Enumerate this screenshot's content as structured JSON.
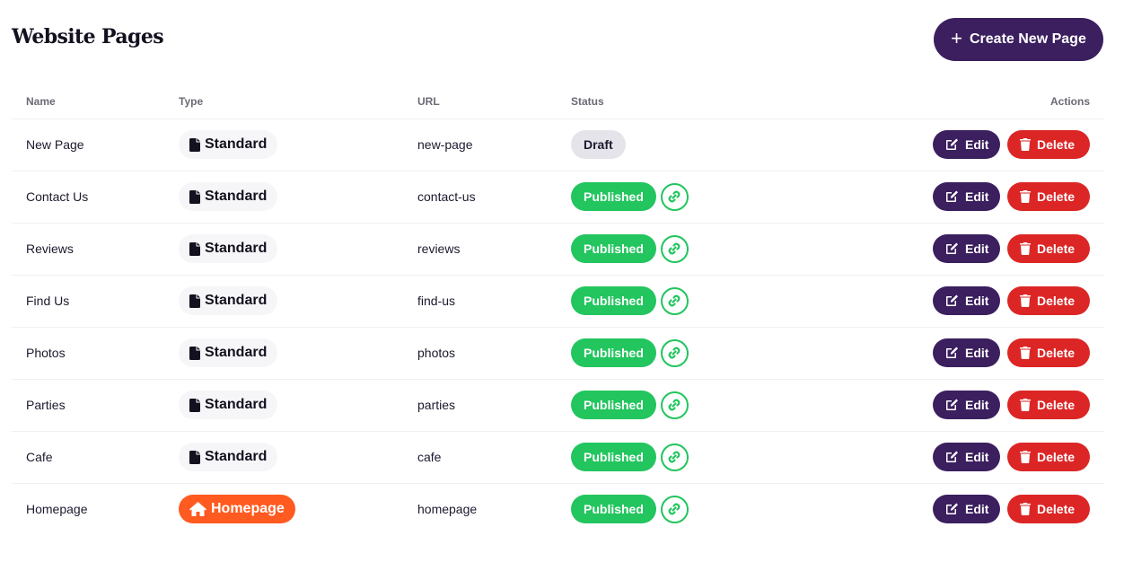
{
  "header": {
    "title": "Website Pages",
    "create_button": "Create New Page"
  },
  "table": {
    "columns": [
      "Name",
      "Type",
      "URL",
      "Status",
      "Actions"
    ],
    "rows": [
      {
        "name": "New Page",
        "type": "Standard",
        "type_icon": "file-icon",
        "url": "new-page",
        "status": "Draft",
        "has_link": false
      },
      {
        "name": "Contact Us",
        "type": "Standard",
        "type_icon": "file-icon",
        "url": "contact-us",
        "status": "Published",
        "has_link": true
      },
      {
        "name": "Reviews",
        "type": "Standard",
        "type_icon": "file-icon",
        "url": "reviews",
        "status": "Published",
        "has_link": true
      },
      {
        "name": "Find Us",
        "type": "Standard",
        "type_icon": "file-icon",
        "url": "find-us",
        "status": "Published",
        "has_link": true
      },
      {
        "name": "Photos",
        "type": "Standard",
        "type_icon": "file-icon",
        "url": "photos",
        "status": "Published",
        "has_link": true
      },
      {
        "name": "Parties",
        "type": "Standard",
        "type_icon": "file-icon",
        "url": "parties",
        "status": "Published",
        "has_link": true
      },
      {
        "name": "Cafe",
        "type": "Standard",
        "type_icon": "file-icon",
        "url": "cafe",
        "status": "Published",
        "has_link": true
      },
      {
        "name": "Homepage",
        "type": "Homepage",
        "type_icon": "home-icon",
        "url": "homepage",
        "status": "Published",
        "has_link": true
      }
    ],
    "actions": {
      "edit": "Edit",
      "delete": "Delete"
    }
  },
  "colors": {
    "primary": "#3b1f5e",
    "danger": "#dc2626",
    "success": "#22c55e",
    "homepage": "#ff5a1f",
    "draft": "#e5e4ea"
  }
}
